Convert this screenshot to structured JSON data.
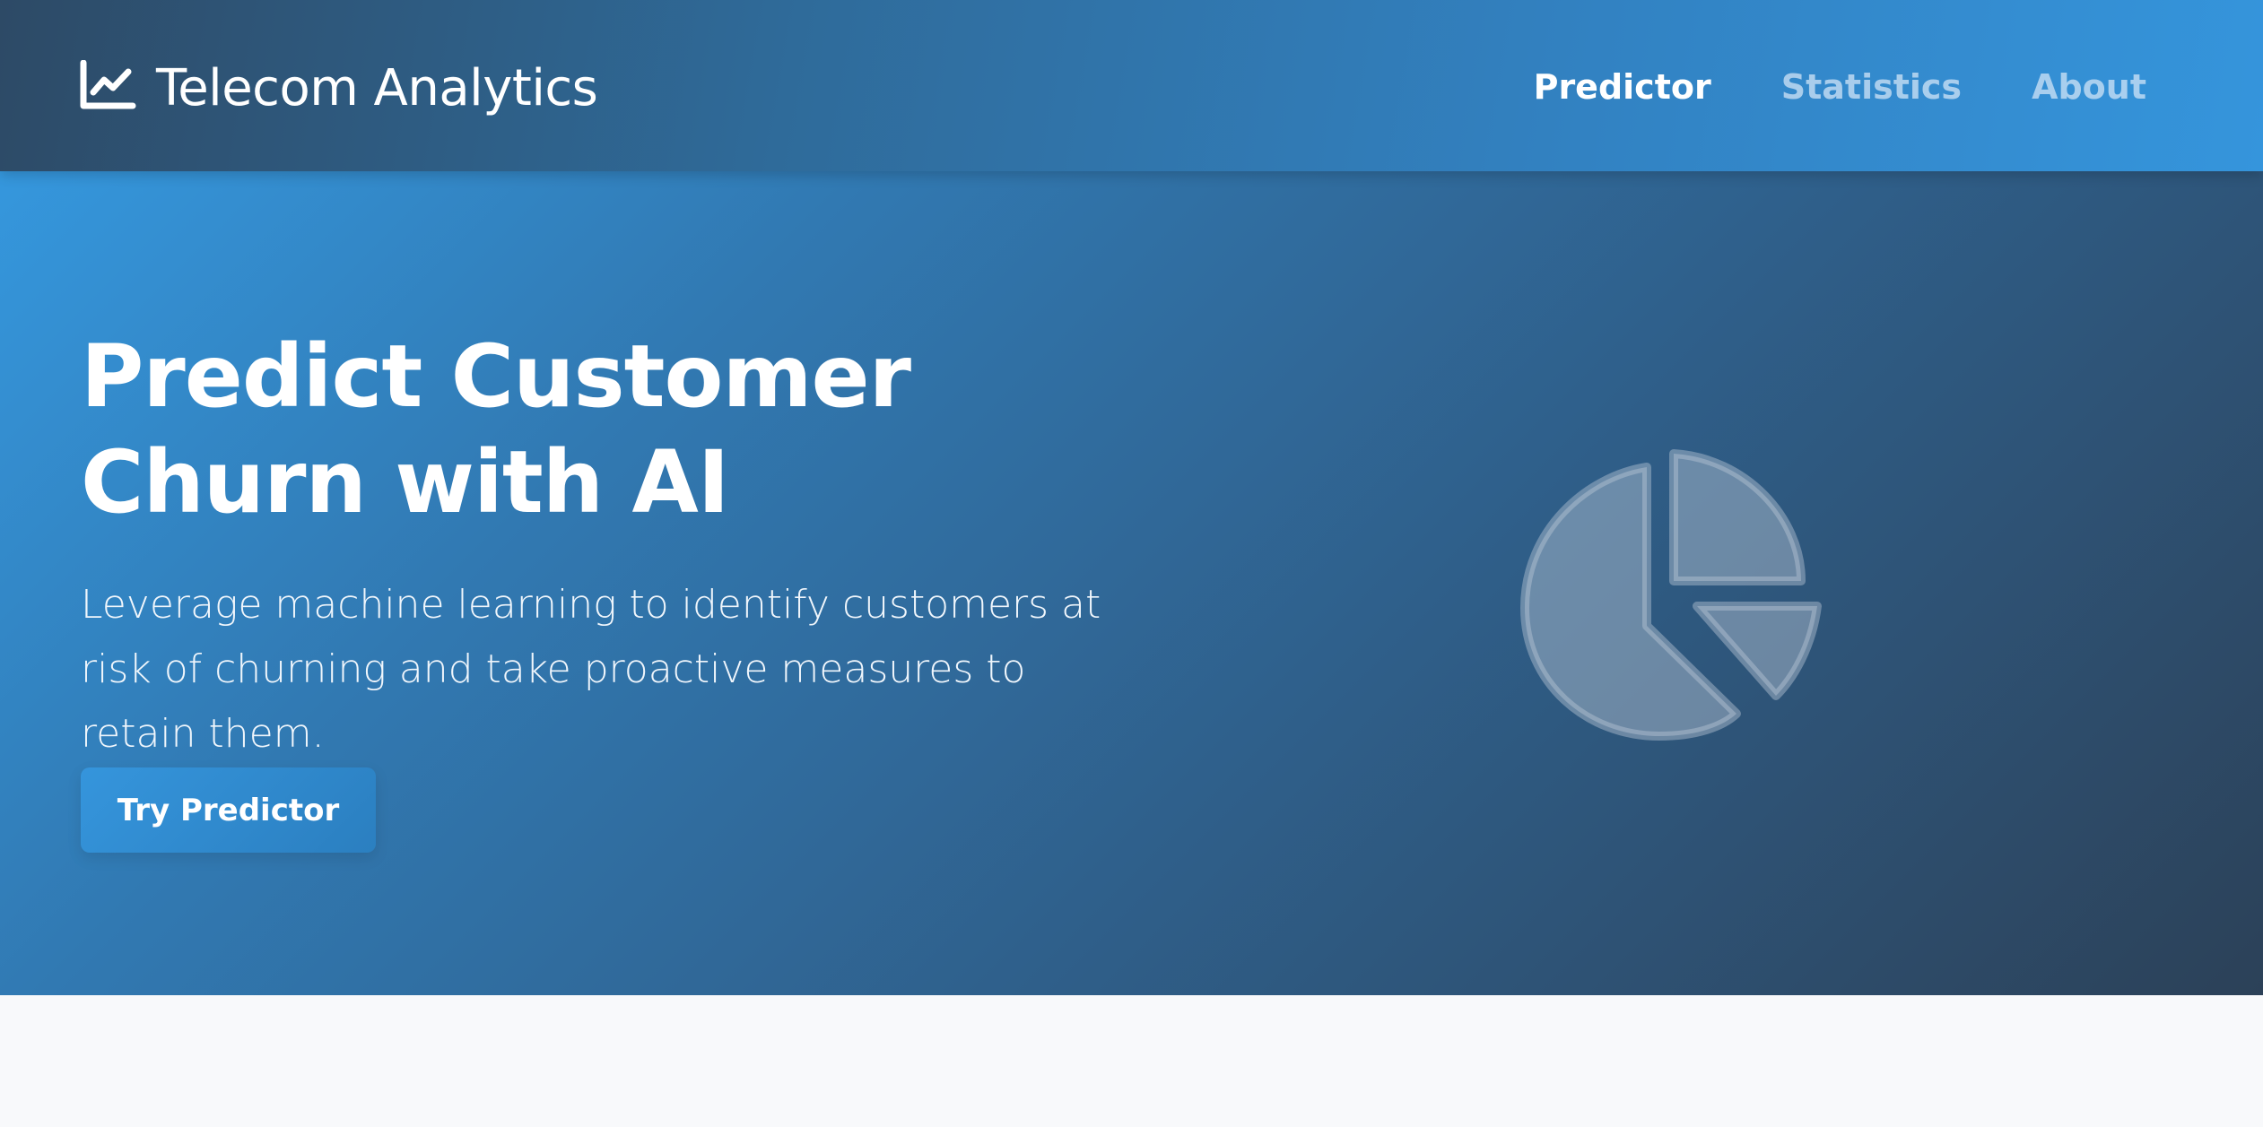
{
  "navbar": {
    "brand": {
      "icon": "chart-line-icon",
      "title": "Telecom Analytics"
    },
    "links": [
      {
        "label": "Predictor",
        "active": true
      },
      {
        "label": "Statistics",
        "active": false
      },
      {
        "label": "About",
        "active": false
      }
    ]
  },
  "hero": {
    "title": "Predict Customer Churn with AI",
    "subtitle": "Leverage machine learning to identify customers at risk of churning and take proactive measures to retain them.",
    "cta_label": "Try Predictor",
    "illustration_icon": "chart-pie-icon"
  },
  "colors": {
    "accent": "#3595dc",
    "nav_dark": "#2d4a66",
    "hero_dark": "#2c4158",
    "page_background": "#f8f9fb"
  }
}
